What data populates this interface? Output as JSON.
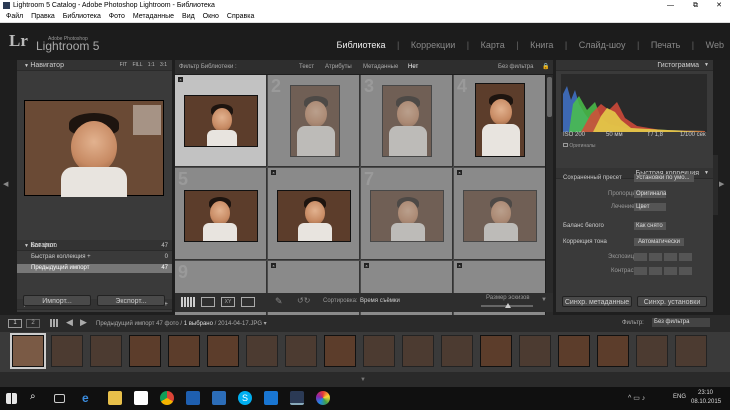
{
  "window": {
    "title": "Lightroom 5 Catalog - Adobe Photoshop Lightroom - Библиотека"
  },
  "menu": [
    "Файл",
    "Правка",
    "Библиотека",
    "Фото",
    "Метаданные",
    "Вид",
    "Окно",
    "Справка"
  ],
  "identity": {
    "logo": "Lr",
    "adobe": "Adobe Photoshop",
    "product": "Lightroom 5"
  },
  "modules": [
    "Библиотека",
    "Коррекции",
    "Карта",
    "Книга",
    "Слайд-шоу",
    "Печать",
    "Web"
  ],
  "left": {
    "navigator": "Навигатор",
    "zoom": [
      "FIT",
      "FILL",
      "1:1",
      "3:1"
    ],
    "catalog": "Каталог",
    "catalog_items": [
      {
        "label": "Все фото",
        "count": "47"
      },
      {
        "label": "Быстрая коллекция +",
        "count": "0"
      },
      {
        "label": "Предыдущий импорт",
        "count": "47"
      }
    ],
    "folders": "Папка",
    "import_btn": "Импорт...",
    "export_btn": "Экспорт..."
  },
  "filterbar": {
    "title": "Фильтр Библиотеки :",
    "tabs": [
      "Текст",
      "Атрибуты",
      "Метаданные",
      "Нет"
    ],
    "preset": "Без фильтра"
  },
  "grid_numbers": [
    "1",
    "2",
    "3",
    "4",
    "5",
    "6",
    "7",
    "8",
    "9"
  ],
  "toolbar": {
    "sort_label": "Сортировка:",
    "sort_value": "Время съёмки",
    "thumb_size": "Размер эскизов"
  },
  "right": {
    "histogram": "Гистограмма",
    "exif": [
      "ISO 200",
      "50 мм",
      "f / 1,8",
      "1/100 сек"
    ],
    "originals": "Оригиналы",
    "quick": "Быстрая коррекция",
    "saved_preset": "Сохраненный пресет",
    "saved_preset_val": "Установки по умо...",
    "crop": "Пропорции обрезки",
    "crop_val": "Оригинала",
    "treatment": "Лечение",
    "treatment_val": "Цвет",
    "wb": "Баланс белого",
    "wb_val": "Как снято",
    "tone": "Коррекция тона",
    "auto_btn": "Автоматически",
    "exposure": "Экспозиция",
    "contrast": "Контраст",
    "sync_meta": "Синхр. метаданные",
    "sync_settings": "Синхр. установки"
  },
  "filmstrip": {
    "views": [
      "1",
      "2"
    ],
    "info": "Предыдущий импорт",
    "count": "47 фото",
    "selected": "1 выбрано",
    "file": "2014-04-17.JPG",
    "filter_label": "Фильтр:",
    "filter_val": "Без фильтра"
  },
  "taskbar": {
    "lang": "ENG",
    "time": "23:10",
    "date": "08.10.2015"
  }
}
